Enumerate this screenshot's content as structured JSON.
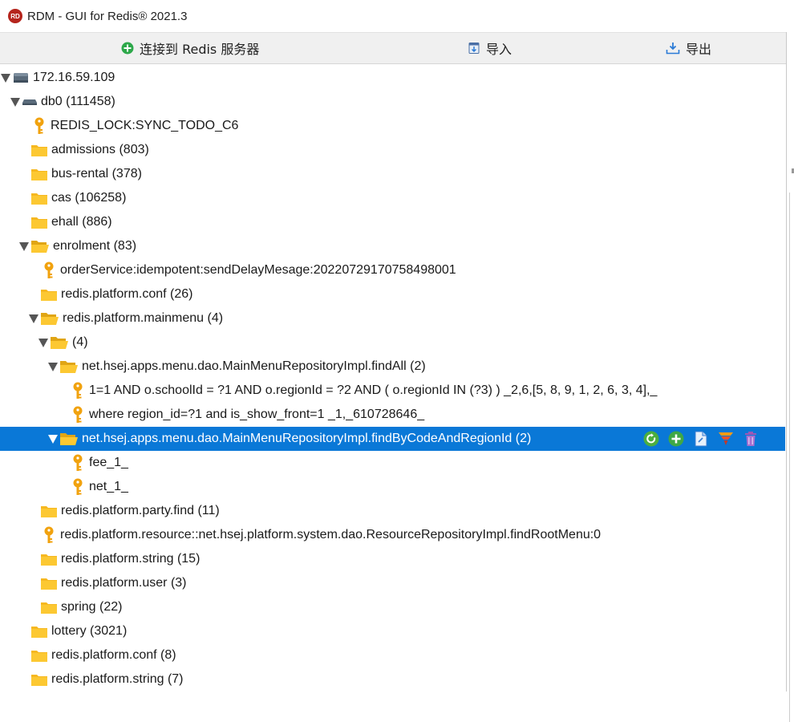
{
  "window": {
    "title": "RDM - GUI for Redis® 2021.3"
  },
  "toolbar": {
    "connect_label": "连接到 Redis 服务器",
    "import_label": "导入",
    "export_label": "导出"
  },
  "colors": {
    "selection": "#0a78d7",
    "folder": "#f6b820",
    "key": "#f1a20e",
    "db": "#5a6b7b"
  },
  "tree": [
    {
      "label": "172.16.59.109",
      "icon": "server-icon",
      "expanded": true
    },
    {
      "label": "db0  (111458)",
      "icon": "database-icon",
      "expanded": true
    },
    {
      "label": "REDIS_LOCK:SYNC_TODO_C6",
      "icon": "key-icon"
    },
    {
      "label": "admissions (803)",
      "icon": "folder-icon"
    },
    {
      "label": "bus-rental (378)",
      "icon": "folder-icon"
    },
    {
      "label": "cas (106258)",
      "icon": "folder-icon"
    },
    {
      "label": "ehall (886)",
      "icon": "folder-icon"
    },
    {
      "label": "enrolment (83)",
      "icon": "folder-open-icon",
      "expanded": true
    },
    {
      "label": "orderService:idempotent:sendDelayMesage:20220729170758498001",
      "icon": "key-icon"
    },
    {
      "label": "redis.platform.conf (26)",
      "icon": "folder-icon"
    },
    {
      "label": "redis.platform.mainmenu (4)",
      "icon": "folder-open-icon",
      "expanded": true
    },
    {
      "label": " (4)",
      "icon": "folder-open-icon",
      "expanded": true
    },
    {
      "label": "net.hsej.apps.menu.dao.MainMenuRepositoryImpl.findAll (2)",
      "icon": "folder-open-icon",
      "expanded": true
    },
    {
      "label": "1=1 AND o.schoolId = ?1 AND o.regionId = ?2 AND  (  o.regionId  IN (?3)  ) _2,6,[5, 8, 9, 1, 2, 6, 3, 4],_",
      "icon": "key-icon"
    },
    {
      "label": "where region_id=?1 and is_show_front=1 _1,_610728646_",
      "icon": "key-icon"
    },
    {
      "label": "net.hsej.apps.menu.dao.MainMenuRepositoryImpl.findByCodeAndRegionId (2)",
      "icon": "folder-open-icon",
      "expanded": true,
      "selected": true
    },
    {
      "label": "fee_1_",
      "icon": "key-icon"
    },
    {
      "label": "net_1_",
      "icon": "key-icon"
    },
    {
      "label": "redis.platform.party.find (11)",
      "icon": "folder-icon"
    },
    {
      "label": "redis.platform.resource::net.hsej.platform.system.dao.ResourceRepositoryImpl.findRootMenu:0",
      "icon": "key-icon"
    },
    {
      "label": "redis.platform.string (15)",
      "icon": "folder-icon"
    },
    {
      "label": "redis.platform.user (3)",
      "icon": "folder-icon"
    },
    {
      "label": "spring (22)",
      "icon": "folder-icon"
    },
    {
      "label": "lottery (3021)",
      "icon": "folder-icon"
    },
    {
      "label": "redis.platform.conf (8)",
      "icon": "folder-icon"
    },
    {
      "label": "redis.platform.string (7)",
      "icon": "folder-icon"
    }
  ],
  "row_actions": [
    "reload-icon",
    "add-icon",
    "copy-icon",
    "filter-icon",
    "delete-icon"
  ]
}
